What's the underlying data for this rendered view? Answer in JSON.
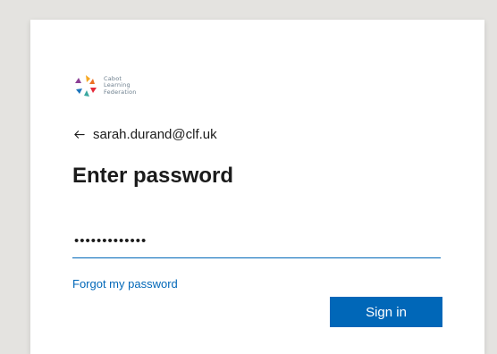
{
  "logo": {
    "icon": "cabot-learning-federation-logo",
    "line1": "Cabot",
    "line2": "Learning",
    "line3": "Federation"
  },
  "identity": {
    "back_icon": "back-arrow-icon",
    "email": "sarah.durand@clf.uk"
  },
  "page": {
    "title": "Enter password"
  },
  "password": {
    "masked_value": "•••••••••••••"
  },
  "links": {
    "forgot_password": "Forgot my password"
  },
  "buttons": {
    "sign_in": "Sign in"
  },
  "colors": {
    "accent": "#0067b8",
    "page_background": "#e4e3e0",
    "card_background": "#ffffff",
    "text": "#1b1b1b"
  }
}
